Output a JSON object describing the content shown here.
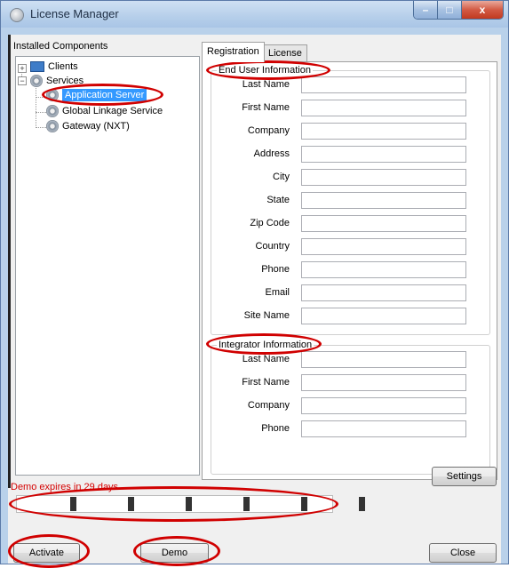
{
  "window": {
    "title": "License Manager",
    "caption_buttons": {
      "minimize": "–",
      "maximize": "□",
      "close": "x"
    }
  },
  "tree": {
    "heading": "Installed Components",
    "nodes": [
      {
        "label": "Clients",
        "icon": "clients-icon",
        "expander": "+"
      },
      {
        "label": "Services",
        "icon": "gear-icon",
        "expander": "−"
      },
      {
        "label": "Application Server",
        "icon": "gear-icon",
        "selected": true
      },
      {
        "label": "Global Linkage Service",
        "icon": "gear-icon"
      },
      {
        "label": "Gateway (NXT)",
        "icon": "gear-icon"
      }
    ]
  },
  "tabs": [
    {
      "label": "Registration",
      "active": true
    },
    {
      "label": "License",
      "active": false
    }
  ],
  "end_user": {
    "heading": "End User Information",
    "fields": [
      {
        "label": "Last Name",
        "value": ""
      },
      {
        "label": "First Name",
        "value": ""
      },
      {
        "label": "Company",
        "value": ""
      },
      {
        "label": "Address",
        "value": ""
      },
      {
        "label": "City",
        "value": ""
      },
      {
        "label": "State",
        "value": ""
      },
      {
        "label": "Zip Code",
        "value": ""
      },
      {
        "label": "Country",
        "value": ""
      },
      {
        "label": "Phone",
        "value": ""
      },
      {
        "label": "Email",
        "value": ""
      },
      {
        "label": "Site Name",
        "value": ""
      }
    ]
  },
  "integrator": {
    "heading": "Integrator Information",
    "fields": [
      {
        "label": "Last Name",
        "value": ""
      },
      {
        "label": "First Name",
        "value": ""
      },
      {
        "label": "Company",
        "value": ""
      },
      {
        "label": "Phone",
        "value": ""
      }
    ]
  },
  "buttons": {
    "settings": "Settings",
    "activate": "Activate",
    "demo": "Demo",
    "close": "Close"
  },
  "demo_status": "Demo expires in 29 days",
  "progress": {
    "block_count": 6
  },
  "colors": {
    "annotation": "#d00000",
    "selection": "#3399ff",
    "window_frame": "#b9d1ea"
  }
}
